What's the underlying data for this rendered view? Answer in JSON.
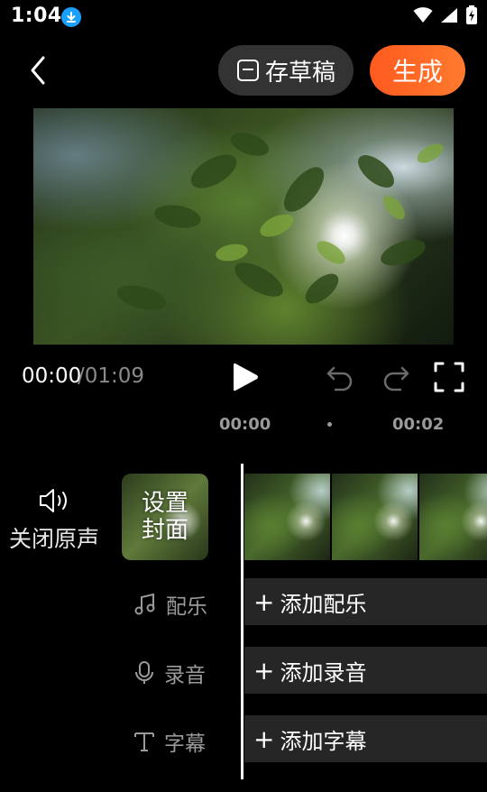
{
  "status_bar": {
    "time": "1:04",
    "icons": [
      "download-icon",
      "wifi-icon",
      "signal-icon",
      "battery-charging-icon"
    ]
  },
  "header": {
    "back_icon": "chevron-left-icon",
    "draft_label": "存草稿",
    "generate_label": "生成",
    "generate_color": "#ff6a25"
  },
  "player": {
    "current_time": "00:00",
    "total_time": "/01:09",
    "play_icon": "play-icon",
    "undo_icon": "undo-icon",
    "redo_icon": "redo-icon",
    "fullscreen_icon": "fullscreen-icon"
  },
  "ruler": {
    "ticks": [
      "00:00",
      "00:02"
    ]
  },
  "left_panel": {
    "mute_label": "关闭原声",
    "cover_label": "设置封面",
    "music_label": "配乐",
    "record_label": "录音",
    "subtitle_label": "字幕"
  },
  "tracks": {
    "add_music": "添加配乐",
    "add_record": "添加录音",
    "add_subtitle": "添加字幕"
  }
}
